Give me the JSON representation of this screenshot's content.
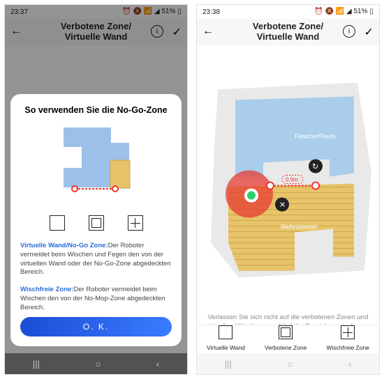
{
  "left": {
    "status": {
      "time": "23:37",
      "icons": "⏰ 🔕 📶 ◢ 51%",
      "battery": "▯"
    },
    "appbar": {
      "title_l1": "Verbotene Zone/",
      "title_l2": "Virtuelle Wand"
    },
    "modal": {
      "title": "So verwenden Sie die No-Go-Zone",
      "para1_b": "Virtuelle Wand/No-Go Zone:",
      "para1": "Der Roboter vermeidet beim Wischen und Fegen den von der virtuellen Wand oder der No-Go-Zone abgedeckten Bereich.",
      "para2_b": "Wischfreie Zone:",
      "para2": "Der Roboter vermeidet beim Wischen den von der No-Mop-Zone abgedeckten Bereich.",
      "ok": "O. K."
    }
  },
  "right": {
    "status": {
      "time": "23:38",
      "icons": "⏰ 🔕 📶 ◢ 51%",
      "battery": "▯"
    },
    "appbar": {
      "title_l1": "Verbotene Zone/",
      "title_l2": "Virtuelle Wand"
    },
    "map": {
      "room1_label": "FalscherRaum",
      "room2_label": "Wohnzimmer",
      "wall_length": "0.9m"
    },
    "hint": "Verlassen Sie sich nicht auf die verbotenen Zonen und virtuellen Wände, um gefährliche Bereiche zu isolieren.",
    "tools": {
      "a": "Virtuelle Wand",
      "b": "Verbotene Zone",
      "c": "Wischfreie Zone"
    }
  },
  "nav": {
    "recent": "|||",
    "home": "○",
    "back": "‹"
  }
}
